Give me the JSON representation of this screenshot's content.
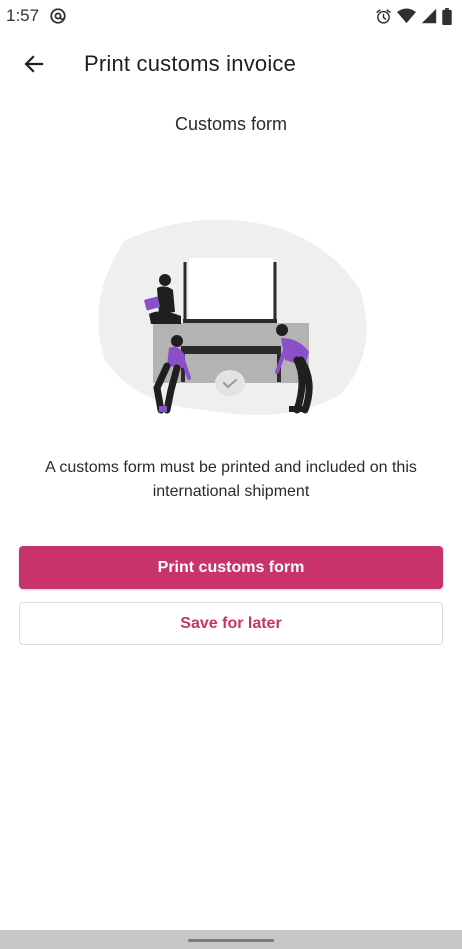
{
  "status_bar": {
    "time": "1:57",
    "icons": [
      "at-sign-icon",
      "alarm-icon",
      "wifi-icon",
      "signal-icon",
      "battery-icon"
    ]
  },
  "app_bar": {
    "title": "Print customs invoice",
    "back_icon": "arrow-left-icon"
  },
  "content": {
    "heading": "Customs form",
    "illustration": "printer-with-people-illustration",
    "description": "A customs form must be printed and included on this international shipment"
  },
  "actions": {
    "primary_label": "Print customs form",
    "secondary_label": "Save for later"
  },
  "colors": {
    "accent": "#c8336b",
    "illustration_purple": "#8a4fc9",
    "blob": "#efefef"
  }
}
